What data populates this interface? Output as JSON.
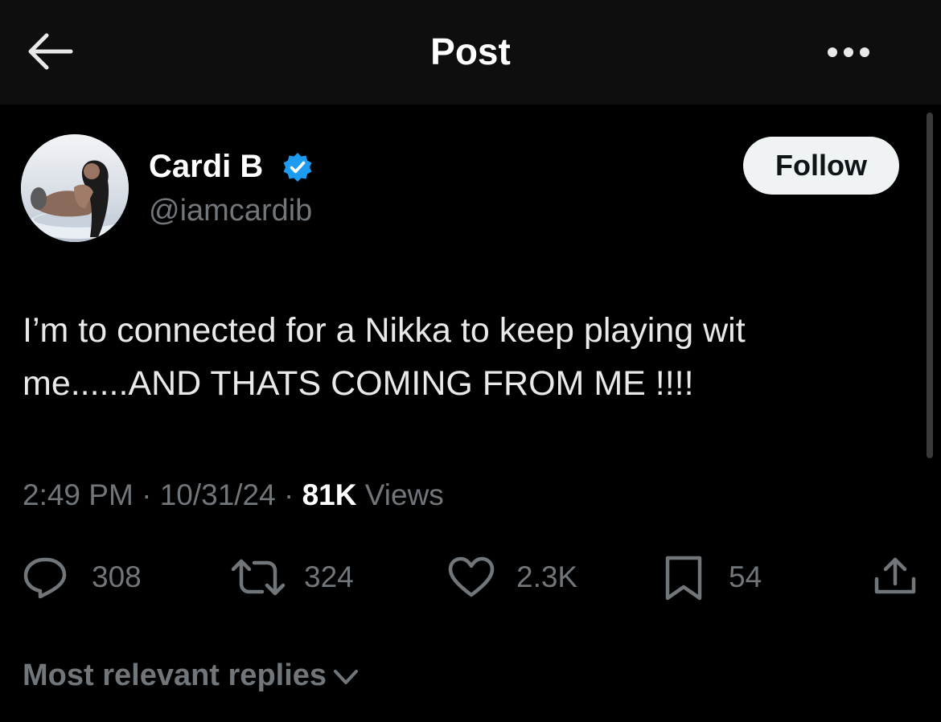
{
  "header": {
    "title": "Post",
    "back_icon": "arrow-left-icon",
    "more_icon": "more-horizontal-icon"
  },
  "author": {
    "display_name": "Cardi B",
    "handle": "@iamcardib",
    "verified": true,
    "verified_color": "#1d9bf0",
    "follow_label": "Follow"
  },
  "post": {
    "text": "I’m to connected for a Nikka to keep playing wit me......AND THATS COMING FROM ME !!!!",
    "time": "2:49 PM",
    "date": "10/31/24",
    "views_count": "81K",
    "views_label": "Views",
    "separator": "·"
  },
  "actions": {
    "replies": "308",
    "reposts": "324",
    "likes": "2.3K",
    "bookmarks": "54"
  },
  "replies_sort": {
    "label": "Most relevant replies"
  },
  "colors": {
    "background": "#000000",
    "text": "#e7e9ea",
    "muted": "#71767b",
    "follow_bg": "#eff3f4"
  }
}
